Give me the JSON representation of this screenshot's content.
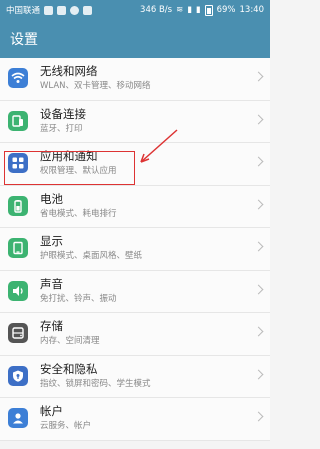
{
  "status_bar": {
    "carrier": "中国联通",
    "speed": "346 B/s",
    "battery": "69%",
    "time": "13:40"
  },
  "app_bar": {
    "title": "设置"
  },
  "settings": [
    {
      "title": "无线和网络",
      "subtitle": "WLAN、双卡管理、移动网络",
      "icon": "wifi-icon",
      "color": "#3d7fd6"
    },
    {
      "title": "设备连接",
      "subtitle": "蓝牙、打印",
      "icon": "device-connect-icon",
      "color": "#3cb371"
    },
    {
      "title": "应用和通知",
      "subtitle": "权限管理、默认应用",
      "icon": "apps-icon",
      "color": "#3d6fc6"
    },
    {
      "title": "电池",
      "subtitle": "省电模式、耗电排行",
      "icon": "battery-icon",
      "color": "#3cb371"
    },
    {
      "title": "显示",
      "subtitle": "护眼模式、桌面风格、壁纸",
      "icon": "display-icon",
      "color": "#3cb371"
    },
    {
      "title": "声音",
      "subtitle": "免打扰、铃声、振动",
      "icon": "sound-icon",
      "color": "#3cb371"
    },
    {
      "title": "存储",
      "subtitle": "内存、空间清理",
      "icon": "storage-icon",
      "color": "#555555"
    },
    {
      "title": "安全和隐私",
      "subtitle": "指纹、锁屏和密码、学生模式",
      "icon": "security-icon",
      "color": "#3d6fc6"
    },
    {
      "title": "帐户",
      "subtitle": "云服务、帐户",
      "icon": "account-icon",
      "color": "#3d7fd6"
    }
  ]
}
